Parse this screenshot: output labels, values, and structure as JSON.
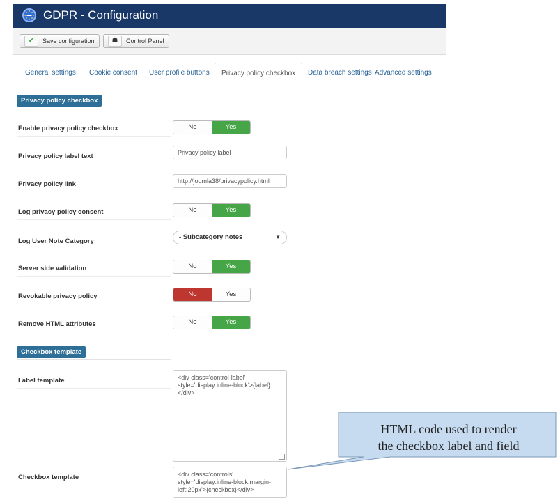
{
  "header": {
    "title": "GDPR - Configuration",
    "logo_icon": "gdpr-stars-icon"
  },
  "toolbar": {
    "save_label": "Save configuration",
    "control_panel_label": "Control Panel"
  },
  "tabs": [
    {
      "label": "General settings",
      "active": false
    },
    {
      "label": "Cookie consent",
      "active": false
    },
    {
      "label": "User profile buttons",
      "active": false
    },
    {
      "label": "Privacy policy checkbox",
      "active": true
    },
    {
      "label": "Data breach settings",
      "active": false
    },
    {
      "label": "Advanced settings",
      "active": false
    }
  ],
  "sections": {
    "privacy": "Privacy policy checkbox",
    "template": "Checkbox template"
  },
  "fields": {
    "enable": {
      "label": "Enable privacy policy checkbox",
      "no": "No",
      "yes": "Yes",
      "value": "Yes"
    },
    "label_text": {
      "label": "Privacy policy label text",
      "value": "Privacy policy label"
    },
    "link": {
      "label": "Privacy policy link",
      "value": "http://joomla38/privacypolicy.html"
    },
    "log_consent": {
      "label": "Log privacy policy consent",
      "no": "No",
      "yes": "Yes",
      "value": "Yes"
    },
    "note_category": {
      "label": "Log User Note Category",
      "value": "- Subcategory notes"
    },
    "server_validation": {
      "label": "Server side validation",
      "no": "No",
      "yes": "Yes",
      "value": "Yes"
    },
    "revokable": {
      "label": "Revokable privacy policy",
      "no": "No",
      "yes": "Yes",
      "value": "No"
    },
    "remove_html": {
      "label": "Remove HTML attributes",
      "no": "No",
      "yes": "Yes",
      "value": "Yes"
    },
    "label_template": {
      "label": "Label template",
      "value": "<div class='control-label' style='display:inline-block'>{label}</div>"
    },
    "checkbox_template": {
      "label": "Checkbox template",
      "value": "<div class='controls' style='display:inline-block;margin-left:20px'>{checkbox}</div>"
    }
  },
  "callout": {
    "line1": "HTML code used to render",
    "line2": "the checkbox label and field"
  },
  "colors": {
    "header": "#1a3867",
    "section": "#2d6f97",
    "yes_active": "#46a546",
    "no_active": "#bd362f",
    "link": "#2a6496"
  }
}
